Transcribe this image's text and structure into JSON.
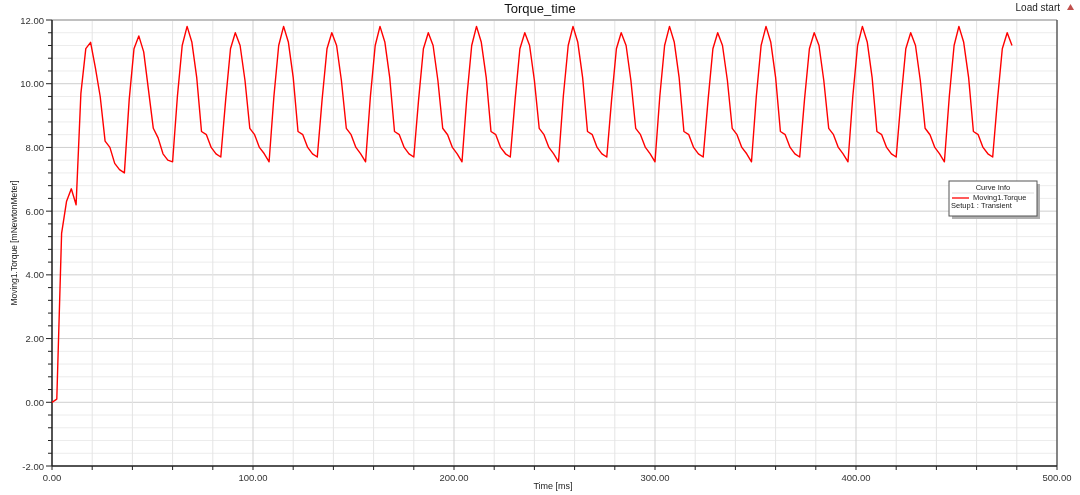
{
  "toolbar": {
    "load_button": "Load start"
  },
  "chart": {
    "chart_data": {
      "type": "line",
      "grid": true,
      "title": "Torque_time",
      "xlabel": "Time [ms]",
      "ylabel": "Moving1.Torque [mNewtonMeter]",
      "xlim": [
        0,
        500
      ],
      "ylim": [
        -2,
        12
      ],
      "xticks": [
        {
          "value": 0,
          "label": "0.00"
        },
        {
          "value": 100,
          "label": "100.00"
        },
        {
          "value": 200,
          "label": "200.00"
        },
        {
          "value": 300,
          "label": "300.00"
        },
        {
          "value": 400,
          "label": "400.00"
        },
        {
          "value": 500,
          "label": "500.00"
        }
      ],
      "yticks": [
        {
          "value": 12,
          "label": "12.00"
        },
        {
          "value": 10,
          "label": "10.00"
        },
        {
          "value": 8,
          "label": "8.00"
        },
        {
          "value": 6,
          "label": "6.00"
        },
        {
          "value": 4,
          "label": "4.00"
        },
        {
          "value": 2,
          "label": "2.00"
        },
        {
          "value": 0,
          "label": "0.00"
        },
        {
          "value": -2,
          "label": "-2.00"
        }
      ],
      "x": [
        0,
        2.4,
        4.8,
        7.2,
        9.6,
        12,
        14.4,
        16.8,
        19.2,
        21.6,
        24,
        26.4,
        28.8,
        31.2,
        33.6,
        36,
        38.4,
        40.8,
        43.2,
        45.6,
        48,
        50.4,
        52.8,
        55.2,
        57.6,
        60,
        62.4,
        64.8,
        67.2,
        69.6,
        72,
        74.4,
        76.8,
        79.2,
        81.6,
        84,
        86.4,
        88.8,
        91.2,
        93.6,
        96,
        98.4,
        100.8,
        103.2,
        105.6,
        108,
        110.4,
        112.8,
        115.2,
        117.6,
        120,
        122.4,
        124.8,
        127.2,
        129.6,
        132,
        134.4,
        136.8,
        139.2,
        141.6,
        144,
        146.4,
        148.8,
        151.2,
        153.6,
        156,
        158.4,
        160.8,
        163.2,
        165.6,
        168,
        170.4,
        172.8,
        175.2,
        177.6,
        180,
        182.4,
        184.8,
        187.2,
        189.6,
        192,
        194.4,
        196.8,
        199.2,
        201.6,
        204,
        206.4,
        208.8,
        211.2,
        213.6,
        216,
        218.4,
        220.8,
        223.2,
        225.6,
        228,
        230.4,
        232.8,
        235.2,
        237.6,
        240,
        242.4,
        244.8,
        247.2,
        249.6,
        252,
        254.4,
        256.8,
        259.2,
        261.6,
        264,
        266.4,
        268.8,
        271.2,
        273.6,
        276,
        278.4,
        280.8,
        283.2,
        285.6,
        288,
        290.4,
        292.8,
        295.2,
        297.6,
        300,
        302.4,
        304.8,
        307.2,
        309.6,
        312,
        314.4,
        316.8,
        319.2,
        321.6,
        324,
        326.4,
        328.8,
        331.2,
        333.6,
        336,
        338.4,
        340.8,
        343.2,
        345.6,
        348,
        350.4,
        352.8,
        355.2,
        357.6,
        360,
        362.4,
        364.8,
        367.2,
        369.6,
        372,
        374.4,
        376.8,
        379.2,
        381.6,
        384,
        386.4,
        388.8,
        391.2,
        393.6,
        396,
        398.4,
        400.8,
        403.2,
        405.6,
        408,
        410.4,
        412.8,
        415.2,
        417.6,
        420,
        422.4,
        424.8,
        427.2,
        429.6,
        432,
        434.4,
        436.8,
        439.2,
        441.6,
        444,
        446.4,
        448.8,
        451.2,
        453.6,
        456,
        458.4,
        460.8,
        463.2,
        465.6,
        468,
        470.4,
        472.8,
        475.2,
        477.6
      ],
      "series": [
        {
          "name": "Moving1.Torque",
          "color": "#ff0000",
          "values": [
            0,
            0.1,
            5.3,
            6.3,
            6.7,
            6.2,
            9.7,
            11.1,
            11.3,
            10.5,
            9.6,
            8.2,
            8.0,
            7.5,
            7.3,
            7.2,
            9.5,
            11.1,
            11.5,
            11.0,
            9.8,
            8.6,
            8.3,
            7.8,
            7.6,
            7.55,
            9.6,
            11.2,
            11.8,
            11.3,
            10.2,
            8.5,
            8.4,
            8.0,
            7.8,
            7.7,
            9.5,
            11.1,
            11.6,
            11.2,
            10.1,
            8.6,
            8.4,
            8.0,
            7.8,
            7.55,
            9.6,
            11.2,
            11.8,
            11.3,
            10.2,
            8.5,
            8.4,
            8.0,
            7.8,
            7.7,
            9.5,
            11.1,
            11.6,
            11.2,
            10.1,
            8.6,
            8.4,
            8.0,
            7.8,
            7.55,
            9.6,
            11.2,
            11.8,
            11.3,
            10.2,
            8.5,
            8.4,
            8.0,
            7.8,
            7.7,
            9.5,
            11.1,
            11.6,
            11.2,
            10.1,
            8.6,
            8.4,
            8.0,
            7.8,
            7.55,
            9.6,
            11.2,
            11.8,
            11.3,
            10.2,
            8.5,
            8.4,
            8.0,
            7.8,
            7.7,
            9.5,
            11.1,
            11.6,
            11.2,
            10.1,
            8.6,
            8.4,
            8.0,
            7.8,
            7.55,
            9.6,
            11.2,
            11.8,
            11.3,
            10.2,
            8.5,
            8.4,
            8.0,
            7.8,
            7.7,
            9.5,
            11.1,
            11.6,
            11.2,
            10.1,
            8.6,
            8.4,
            8.0,
            7.8,
            7.55,
            9.6,
            11.2,
            11.8,
            11.3,
            10.2,
            8.5,
            8.4,
            8.0,
            7.8,
            7.7,
            9.5,
            11.1,
            11.6,
            11.2,
            10.1,
            8.6,
            8.4,
            8.0,
            7.8,
            7.55,
            9.6,
            11.2,
            11.8,
            11.3,
            10.2,
            8.5,
            8.4,
            8.0,
            7.8,
            7.7,
            9.5,
            11.1,
            11.6,
            11.2,
            10.1,
            8.6,
            8.4,
            8.0,
            7.8,
            7.55,
            9.6,
            11.2,
            11.8,
            11.3,
            10.2,
            8.5,
            8.4,
            8.0,
            7.8,
            7.7,
            9.5,
            11.1,
            11.6,
            11.2,
            10.1,
            8.6,
            8.4,
            8.0,
            7.8,
            7.55,
            9.6,
            11.2,
            11.8,
            11.3,
            10.2,
            8.5,
            8.4,
            8.0,
            7.8,
            7.7,
            9.5,
            11.1,
            11.6,
            11.2
          ]
        }
      ]
    },
    "legend": {
      "title": "Curve Info",
      "context": "Setup1 : Transient"
    }
  }
}
